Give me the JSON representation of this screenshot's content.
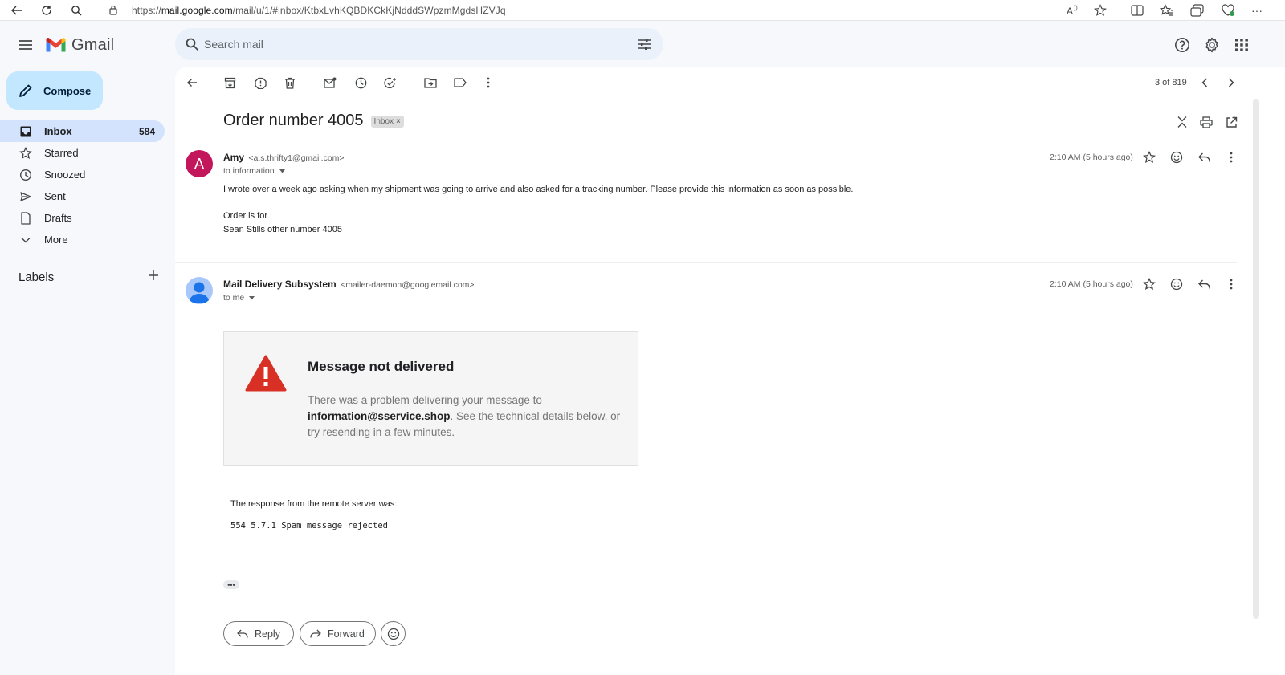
{
  "browser": {
    "url_prefix": "https://",
    "url_domain": "mail.google.com",
    "url_path": "/mail/u/1/#inbox/KtbxLvhKQBDKCkKjNdddSWpzmMgdsHZVJq"
  },
  "app": {
    "name": "Gmail",
    "search_placeholder": "Search mail"
  },
  "sidebar": {
    "compose_label": "Compose",
    "items": [
      {
        "label": "Inbox",
        "count": "584"
      },
      {
        "label": "Starred",
        "count": ""
      },
      {
        "label": "Snoozed",
        "count": ""
      },
      {
        "label": "Sent",
        "count": ""
      },
      {
        "label": "Drafts",
        "count": ""
      },
      {
        "label": "More",
        "count": ""
      }
    ],
    "labels_title": "Labels"
  },
  "toolbar": {
    "pager": "3 of 819"
  },
  "thread": {
    "subject": "Order number 4005",
    "chip": "Inbox",
    "chip_close": "×"
  },
  "messages": [
    {
      "avatar_letter": "A",
      "avatar_color": "#c2185b",
      "sender_name": "Amy",
      "sender_email": "<a.s.thrifty1@gmail.com>",
      "recipient": "to information",
      "time": "2:10 AM (5 hours ago)",
      "body": [
        "I wrote over a week ago asking when my shipment was going to arrive and also asked for a tracking number. Please provide this information as soon as possible.",
        "Order is for",
        "Sean Stills other number 4005"
      ]
    },
    {
      "sender_name": "Mail Delivery Subsystem",
      "sender_email": "<mailer-daemon@googlemail.com>",
      "recipient": "to me",
      "time": "2:10 AM (5 hours ago)",
      "error_title": "Message not delivered",
      "error_body_1": "There was a problem delivering your message to ",
      "error_address": "information@sservice.shop",
      "error_body_2": ". See the technical details below, or try resending in a few minutes.",
      "response_label": "The response from the remote server was:",
      "response_code": "554 5.7.1 Spam message rejected"
    }
  ],
  "actions": {
    "reply": "Reply",
    "forward": "Forward",
    "more_dots": "•••"
  },
  "colors": {
    "compose_bg": "#c2e7ff",
    "active_nav": "#d3e3fd",
    "warning_red": "#d93025"
  }
}
